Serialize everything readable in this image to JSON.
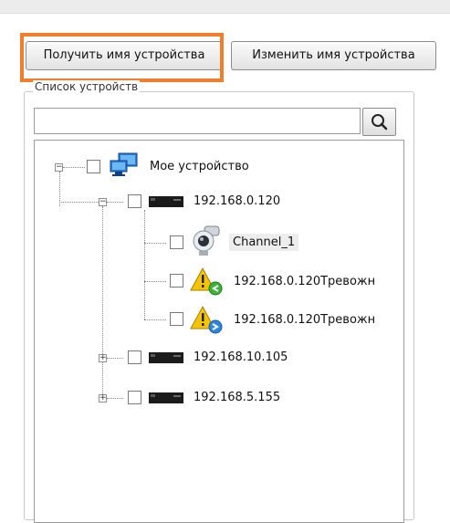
{
  "toolbar": {
    "get_name_label": "Получить имя устройства",
    "change_name_label": "Изменить имя устройства"
  },
  "device_list": {
    "group_label": "Список устройств",
    "search": {
      "value": "",
      "placeholder": ""
    },
    "search_icon": "magnifier-icon"
  },
  "tree": {
    "root": {
      "label": "Мое устройство",
      "icon": "computer-icon",
      "expanded": true
    },
    "nodes": [
      {
        "label": "192.168.0.120",
        "icon": "dvr-icon",
        "expanded": true
      },
      {
        "label": "Channel_1",
        "icon": "camera-icon",
        "selected": true
      },
      {
        "label": "192.168.0.120Тревожн",
        "icon": "alarm-in-icon"
      },
      {
        "label": "192.168.0.120Тревожн",
        "icon": "alarm-out-icon"
      },
      {
        "label": "192.168.10.105",
        "icon": "dvr-icon",
        "expanded": false
      },
      {
        "label": "192.168.5.155",
        "icon": "dvr-icon",
        "expanded": false
      }
    ]
  },
  "colors": {
    "highlight": "#f27d2a",
    "border": "#9a9a9a"
  }
}
